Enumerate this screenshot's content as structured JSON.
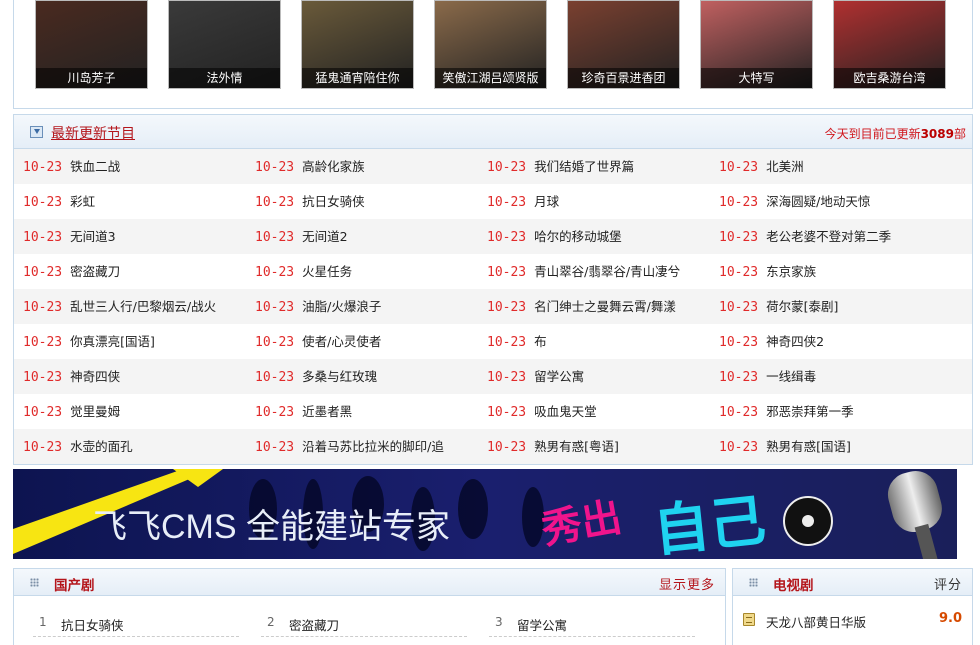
{
  "posters": [
    {
      "title": "川岛芳子",
      "bg": "#4a2a20"
    },
    {
      "title": "法外情",
      "bg": "#3a3a3a"
    },
    {
      "title": "猛鬼通宵陪住你",
      "bg": "#6a5a3a"
    },
    {
      "title": "笑傲江湖吕颂贤版",
      "bg": "#8a6a4a"
    },
    {
      "title": "珍奇百景进香团",
      "bg": "#7a4030"
    },
    {
      "title": "大特写",
      "bg": "#c06060"
    },
    {
      "title": "欧吉桑游台湾",
      "bg": "#b03030"
    }
  ],
  "latest": {
    "title": "最新更新节目",
    "count_prefix": "今天到目前已更新",
    "count_value": "3089",
    "count_suffix": "部",
    "rows": [
      [
        {
          "d": "10-23",
          "t": "铁血二战"
        },
        {
          "d": "10-23",
          "t": "高龄化家族"
        },
        {
          "d": "10-23",
          "t": "我们结婚了世界篇"
        },
        {
          "d": "10-23",
          "t": "北美洲"
        }
      ],
      [
        {
          "d": "10-23",
          "t": "彩虹"
        },
        {
          "d": "10-23",
          "t": "抗日女骑侠"
        },
        {
          "d": "10-23",
          "t": "月球"
        },
        {
          "d": "10-23",
          "t": "深海圆疑/地动天惊"
        }
      ],
      [
        {
          "d": "10-23",
          "t": "无间道3"
        },
        {
          "d": "10-23",
          "t": "无间道2"
        },
        {
          "d": "10-23",
          "t": "哈尔的移动城堡"
        },
        {
          "d": "10-23",
          "t": "老公老婆不登对第二季"
        }
      ],
      [
        {
          "d": "10-23",
          "t": "密盗藏刀"
        },
        {
          "d": "10-23",
          "t": "火星任务"
        },
        {
          "d": "10-23",
          "t": "青山翠谷/翡翠谷/青山凄兮"
        },
        {
          "d": "10-23",
          "t": "东京家族"
        }
      ],
      [
        {
          "d": "10-23",
          "t": "乱世三人行/巴黎烟云/战火"
        },
        {
          "d": "10-23",
          "t": "油脂/火爆浪子"
        },
        {
          "d": "10-23",
          "t": "名门绅士之曼舞云霄/舞漾"
        },
        {
          "d": "10-23",
          "t": "荷尔蒙[泰剧]"
        }
      ],
      [
        {
          "d": "10-23",
          "t": "你真漂亮[国语]"
        },
        {
          "d": "10-23",
          "t": "使者/心灵使者"
        },
        {
          "d": "10-23",
          "t": "布"
        },
        {
          "d": "10-23",
          "t": "神奇四侠2"
        }
      ],
      [
        {
          "d": "10-23",
          "t": "神奇四侠"
        },
        {
          "d": "10-23",
          "t": "多桑与红玫瑰"
        },
        {
          "d": "10-23",
          "t": "留学公寓"
        },
        {
          "d": "10-23",
          "t": "一线缉毒"
        }
      ],
      [
        {
          "d": "10-23",
          "t": "觉里曼姆"
        },
        {
          "d": "10-23",
          "t": "近墨者黑"
        },
        {
          "d": "10-23",
          "t": "吸血鬼天堂"
        },
        {
          "d": "10-23",
          "t": "邪恶崇拜第一季"
        }
      ],
      [
        {
          "d": "10-23",
          "t": "水壶的面孔"
        },
        {
          "d": "10-23",
          "t": "沿着马苏比拉米的脚印/追"
        },
        {
          "d": "10-23",
          "t": "熟男有惑[粤语]"
        },
        {
          "d": "10-23",
          "t": "熟男有惑[国语]"
        }
      ]
    ]
  },
  "banner": {
    "slogan": "飞飞CMS 全能建站专家",
    "tag1": "秀出",
    "tag2": "自己"
  },
  "guochan": {
    "title": "国产剧",
    "more": "显示更多",
    "items": [
      {
        "n": "1",
        "name": "抗日女骑侠"
      },
      {
        "n": "2",
        "name": "密盗藏刀"
      },
      {
        "n": "3",
        "name": "留学公寓"
      }
    ]
  },
  "tv": {
    "title": "电视剧",
    "score_label": "评分",
    "items": [
      {
        "name": "天龙八部黄日华版",
        "score": "9.0"
      }
    ]
  },
  "colors": {
    "accent_red": "#b4151b",
    "date_red": "#e02a2a",
    "border_blue": "#c6d9ea",
    "score_orange": "#d64a00"
  }
}
